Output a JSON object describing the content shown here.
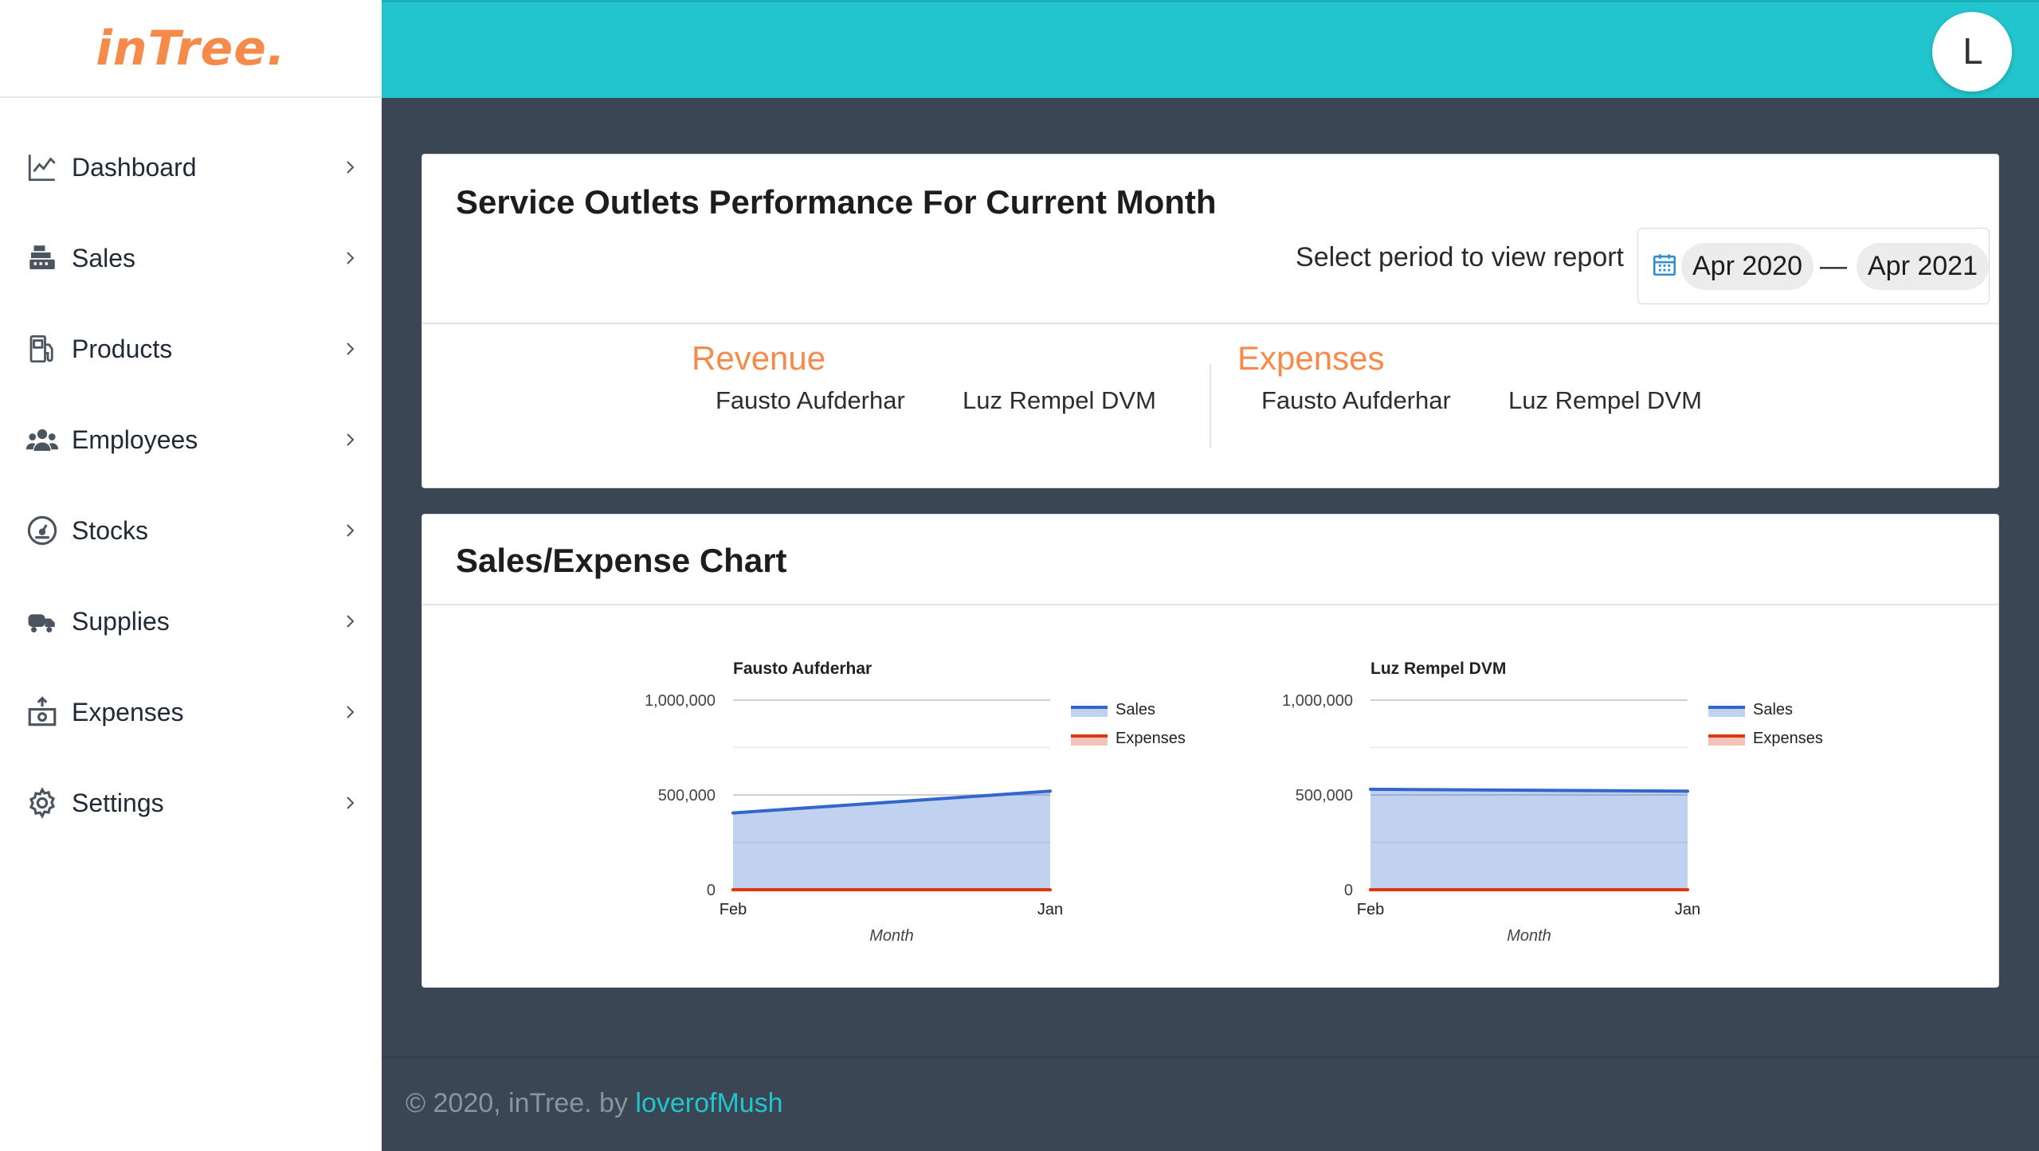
{
  "brand": {
    "logo": "inTree."
  },
  "user": {
    "avatar_initial": "L"
  },
  "sidebar": {
    "items": [
      {
        "label": "Dashboard",
        "icon": "line-chart-icon"
      },
      {
        "label": "Sales",
        "icon": "cash-register-icon"
      },
      {
        "label": "Products",
        "icon": "fuel-pump-icon"
      },
      {
        "label": "Employees",
        "icon": "users-icon"
      },
      {
        "label": "Stocks",
        "icon": "gauge-icon"
      },
      {
        "label": "Supplies",
        "icon": "truck-icon"
      },
      {
        "label": "Expenses",
        "icon": "money-icon"
      },
      {
        "label": "Settings",
        "icon": "gear-icon"
      }
    ]
  },
  "performance": {
    "title": "Service Outlets Performance For Current Month",
    "period_label": "Select period to view report",
    "period_start": "Apr 2020",
    "period_separator": "—",
    "period_end": "Apr 2021",
    "revenue": {
      "title": "Revenue",
      "names": [
        "Fausto Aufderhar",
        "Luz Rempel DVM"
      ]
    },
    "expenses": {
      "title": "Expenses",
      "names": [
        "Fausto Aufderhar",
        "Luz Rempel DVM"
      ]
    }
  },
  "chart_card": {
    "title": "Sales/Expense Chart"
  },
  "chart_data": [
    {
      "type": "area",
      "title": "Fausto Aufderhar",
      "xlabel": "Month",
      "ylabel": "",
      "categories": [
        "Feb",
        "Jan"
      ],
      "series": [
        {
          "name": "Sales",
          "values": [
            405000,
            520000
          ],
          "color": "#3366cc"
        },
        {
          "name": "Expenses",
          "values": [
            0,
            0
          ],
          "color": "#dc3912"
        }
      ],
      "yticks": [
        "0",
        "500,000",
        "1,000,000"
      ],
      "ylim": [
        0,
        1000000
      ],
      "legend": "right"
    },
    {
      "type": "area",
      "title": "Luz Rempel DVM",
      "xlabel": "Month",
      "ylabel": "",
      "categories": [
        "Feb",
        "Jan"
      ],
      "series": [
        {
          "name": "Sales",
          "values": [
            530000,
            520000
          ],
          "color": "#3366cc"
        },
        {
          "name": "Expenses",
          "values": [
            0,
            0
          ],
          "color": "#dc3912"
        }
      ],
      "yticks": [
        "0",
        "500,000",
        "1,000,000"
      ],
      "ylim": [
        0,
        1000000
      ],
      "legend": "right"
    }
  ],
  "footer": {
    "text": "© 2020, inTree. by ",
    "link": "loverofMush"
  },
  "colors": {
    "accent": "#22c4cd",
    "brand": "#f58a4b",
    "background": "#3a4654"
  }
}
